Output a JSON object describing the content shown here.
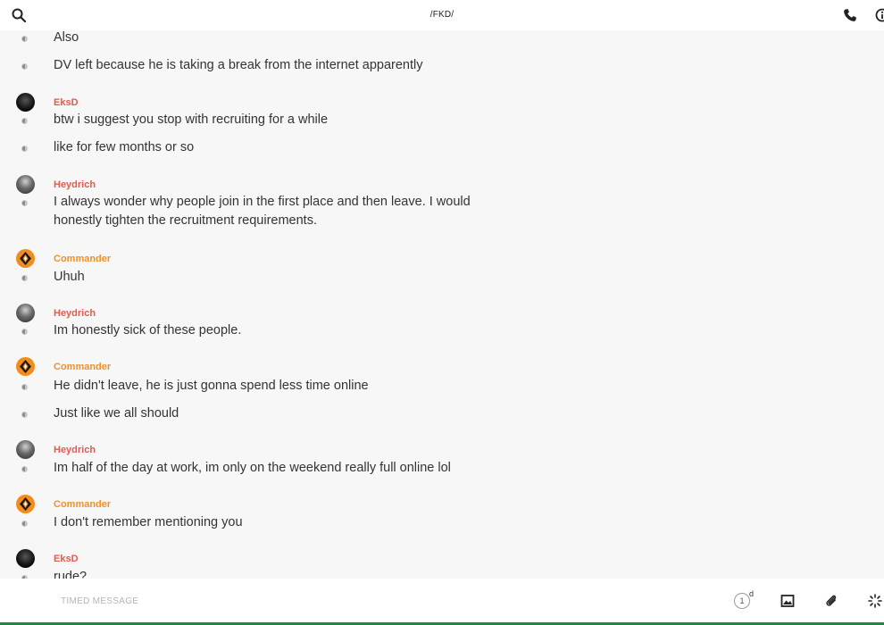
{
  "header": {
    "title": "/FKD/",
    "icons": [
      "search-icon",
      "phone-icon",
      "info-icon"
    ]
  },
  "messages": [
    {
      "sender": "",
      "color": "",
      "lines": [
        "Also"
      ]
    },
    {
      "sender": "",
      "color": "",
      "lines": [
        "DV left because he is taking a break from the internet apparently"
      ]
    },
    {
      "sender": "EksD",
      "color": "#e05a4f",
      "lines": [
        "btw i suggest you stop with recruiting for a while"
      ]
    },
    {
      "sender": "",
      "color": "",
      "lines": [
        "like for few months or so"
      ]
    },
    {
      "sender": "Heydrich",
      "color": "#e05a4f",
      "lines": [
        "I always wonder why people join in the first place and then leave. I would honestly tighten the recruitment requirements."
      ]
    },
    {
      "sender": "Commander",
      "color": "#f0902a",
      "lines": [
        "Uhuh"
      ]
    },
    {
      "sender": "Heydrich",
      "color": "#e05a4f",
      "lines": [
        "Im honestly sick of these people."
      ]
    },
    {
      "sender": "Commander",
      "color": "#f0902a",
      "lines": [
        "He didn't leave, he is just gonna spend less time online"
      ]
    },
    {
      "sender": "",
      "color": "",
      "lines": [
        "Just like we all should"
      ]
    },
    {
      "sender": "Heydrich",
      "color": "#e05a4f",
      "lines": [
        "Im half of the day at work, im only on the weekend really full online lol"
      ]
    },
    {
      "sender": "Commander",
      "color": "#f0902a",
      "lines": [
        "I don't remember mentioning you"
      ]
    },
    {
      "sender": "EksD",
      "color": "#e05a4f",
      "lines": [
        "rude?"
      ]
    }
  ],
  "composer": {
    "placeholder": "TIMED MESSAGE",
    "timer_value": "1",
    "timer_unit": "d",
    "icons": [
      "image-icon",
      "paperclip-icon",
      "loading-icon"
    ]
  }
}
